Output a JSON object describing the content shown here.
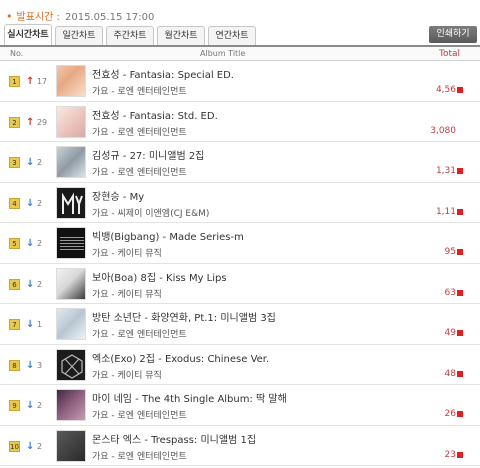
{
  "header": {
    "pub_label": "발표시간 :",
    "pub_time": "2015.05.15 17:00",
    "share_label": "인쇄하기"
  },
  "tabs": [
    {
      "label": "실시간차트",
      "active": true
    },
    {
      "label": "일간차트",
      "active": false
    },
    {
      "label": "주간차트",
      "active": false
    },
    {
      "label": "월간차트",
      "active": false
    },
    {
      "label": "연간차트",
      "active": false
    }
  ],
  "columns": {
    "no": "No.",
    "title": "Album Title",
    "total": "Total"
  },
  "rows": [
    {
      "rank": "1",
      "dir": "up",
      "change": "17",
      "song": "전효성 - Fantasia: Special ED.",
      "sub": "가요 - 로엔 엔터테인먼트",
      "total": "4,56"
    },
    {
      "rank": "2",
      "dir": "up",
      "change": "29",
      "song": "전효성 - Fantasia: Std. ED.",
      "sub": "가요 - 로엔 엔터테인먼트",
      "total": "3,080"
    },
    {
      "rank": "3",
      "dir": "down",
      "change": "2",
      "song": "김성규 - 27: 미니앨범 2집",
      "sub": "가요 - 로엔 엔터테인먼트",
      "total": "1,31"
    },
    {
      "rank": "4",
      "dir": "down",
      "change": "2",
      "song": "장현승 - My",
      "sub": "가요 - 씨제이 이앤엠(CJ E&M)",
      "total": "1,11"
    },
    {
      "rank": "5",
      "dir": "down",
      "change": "2",
      "song": "빅뱅(Bigbang) - Made Series-m",
      "sub": "가요 - 케이티 뮤직",
      "total": "95"
    },
    {
      "rank": "6",
      "dir": "down",
      "change": "2",
      "song": "보아(Boa) 8집 - Kiss My Lips",
      "sub": "가요 - 케이티 뮤직",
      "total": "63"
    },
    {
      "rank": "7",
      "dir": "down",
      "change": "1",
      "song": "방탄 소년단 - 화양연화, Pt.1: 미니앨범 3집",
      "sub": "가요 - 로엔 엔터테인먼트",
      "total": "49"
    },
    {
      "rank": "8",
      "dir": "down",
      "change": "3",
      "song": "엑소(Exo) 2집 - Exodus: Chinese Ver.",
      "sub": "가요 - 케이티 뮤직",
      "total": "48"
    },
    {
      "rank": "9",
      "dir": "down",
      "change": "2",
      "song": "마이 네임 - The 4th Single Album: 딱 말해",
      "sub": "가요 - 로엔 엔터테인먼트",
      "total": "26"
    },
    {
      "rank": "10",
      "dir": "down",
      "change": "2",
      "song": "몬스타 엑스 - Trespass: 미니앨범 1집",
      "sub": "가요 - 로엔 엔터테인먼트",
      "total": "23"
    }
  ],
  "colors": {
    "accent": "#e06a1b",
    "up": "#d2352d",
    "down": "#3b7fd1",
    "bar": "#e02020",
    "rank_badge": "#e9c84a"
  }
}
